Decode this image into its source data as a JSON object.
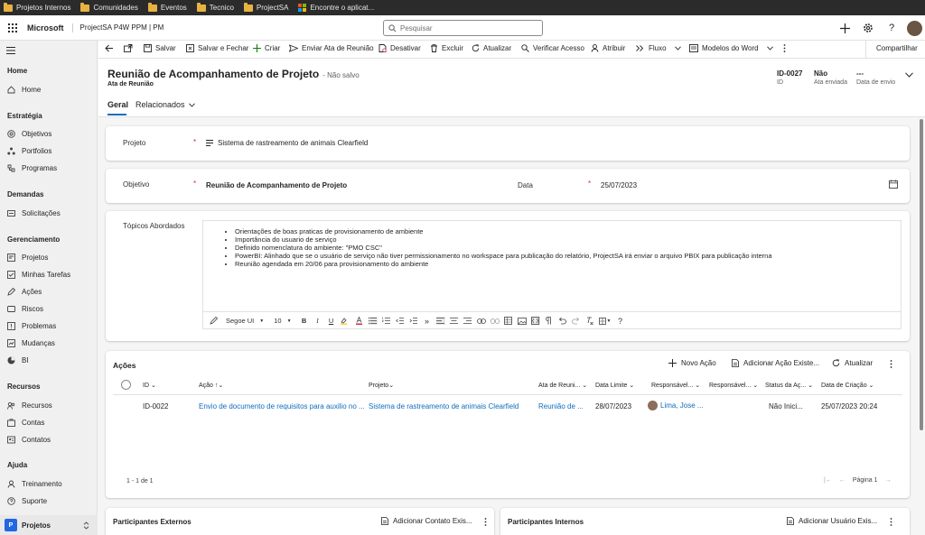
{
  "bookmarks": [
    {
      "label": "Projetos Internos",
      "icon": "folder-icon"
    },
    {
      "label": "Comunidades",
      "icon": "folder-icon"
    },
    {
      "label": "Eventos",
      "icon": "folder-icon"
    },
    {
      "label": "Tecnico",
      "icon": "folder-icon"
    },
    {
      "label": "ProjectSA",
      "icon": "folder-icon"
    },
    {
      "label": "Encontre o aplicat...",
      "icon": "microsoft-logo-icon"
    }
  ],
  "topnav": {
    "brand": "Microsoft",
    "app_name": "ProjectSA P4W PPM | PM",
    "search_placeholder": "Pesquisar"
  },
  "sidebar": {
    "home_header": "Home",
    "home": "Home",
    "strategy_header": "Estratégia",
    "objetivos": "Objetivos",
    "portfolios": "Portfolios",
    "programas": "Programas",
    "demands_header": "Demandas",
    "solicitacoes": "Solicitações",
    "mgmt_header": "Gerenciamento",
    "projetos": "Projetos",
    "tarefas": "Minhas Tarefas",
    "acoes": "Ações",
    "riscos": "Riscos",
    "problemas": "Problemas",
    "mudancas": "Mudanças",
    "bi": "BI",
    "resources_header": "Recursos",
    "recursos": "Recursos",
    "contas": "Contas",
    "contatos": "Contatos",
    "help_header": "Ajuda",
    "treinamento": "Treinamento",
    "suporte": "Suporte",
    "area_badge": "P",
    "area_label": "Projetos"
  },
  "commands": {
    "salvar": "Salvar",
    "salvar_fechar": "Salvar e Fechar",
    "criar": "Criar",
    "enviar_ata": "Enviar Ata de Reunião",
    "desativar": "Desativar",
    "excluir": "Excluir",
    "atualizar": "Atualizar",
    "verificar": "Verificar Acesso",
    "atribuir": "Atribuir",
    "fluxo": "Fluxo",
    "modelos": "Modelos do Word",
    "compartilhar": "Compartilhar"
  },
  "header": {
    "title": "Reunião de Acompanhamento de Projeto",
    "unsaved": "- Não salvo",
    "entity": "Ata de Reunião",
    "id_value": "ID-0027",
    "id_label": "ID",
    "sent_value": "Não",
    "sent_label": "Ata enviada",
    "date_value": "---",
    "date_label": "Data de envio"
  },
  "tabs": {
    "geral": "Geral",
    "relacionados": "Relacionados"
  },
  "form": {
    "projeto_label": "Projeto",
    "projeto_value": "Sistema de rastreamento de animais Clearfield",
    "objetivo_label": "Objetivo",
    "objetivo_value": "Reunião de Acompanhamento de Projeto",
    "data_label": "Data",
    "data_value": "25/07/2023",
    "topicos_label": "Tópicos Abordados",
    "required_mark": "*",
    "topicos": [
      "Orientações de boas praticas de provisionamento de ambiente",
      "Importância do usuario de serviço",
      "Definido nomenclatura do ambiente: \"PMO CSC\"",
      "PowerBI: Alinhado que se o usuário de serviço não tiver permissionamento no workspace para publicação do relatório, ProjectSA irá enviar o arquivo PBIX para publicação interna",
      "Reunião agendada em 20/06 para provisionamento do ambiente"
    ],
    "editor": {
      "font": "Segoe UI",
      "size": "10"
    }
  },
  "acoes": {
    "title": "Ações",
    "novo": "Novo Ação",
    "adicionar": "Adicionar Ação Existe...",
    "atualizar": "Atualizar",
    "columns": {
      "id": "ID",
      "acao": "Ação",
      "projeto": "Projeto",
      "ata": "Ata de Reuni...",
      "limite": "Data Limite",
      "resp1": "Responsável...",
      "resp2": "Responsável...",
      "status": "Status da Aç...",
      "criacao": "Data de Criação"
    },
    "row": {
      "id": "ID-0022",
      "acao": "Envio de documento de requisitos para auxilio no ...",
      "projeto": "Sistema de rastreamento de animais Clearfield",
      "ata": "Reunião de ...",
      "limite": "28/07/2023",
      "resp1": "Lima, Jose ...",
      "status": "Não Inici...",
      "criacao": "25/07/2023 20:24"
    },
    "count": "1 - 1 de 1",
    "page": "Página 1"
  },
  "participantes": {
    "externos_title": "Participantes Externos",
    "externos_add": "Adicionar Contato Exis...",
    "internos_title": "Participantes Internos",
    "internos_add": "Adicionar Usuário Exis..."
  }
}
